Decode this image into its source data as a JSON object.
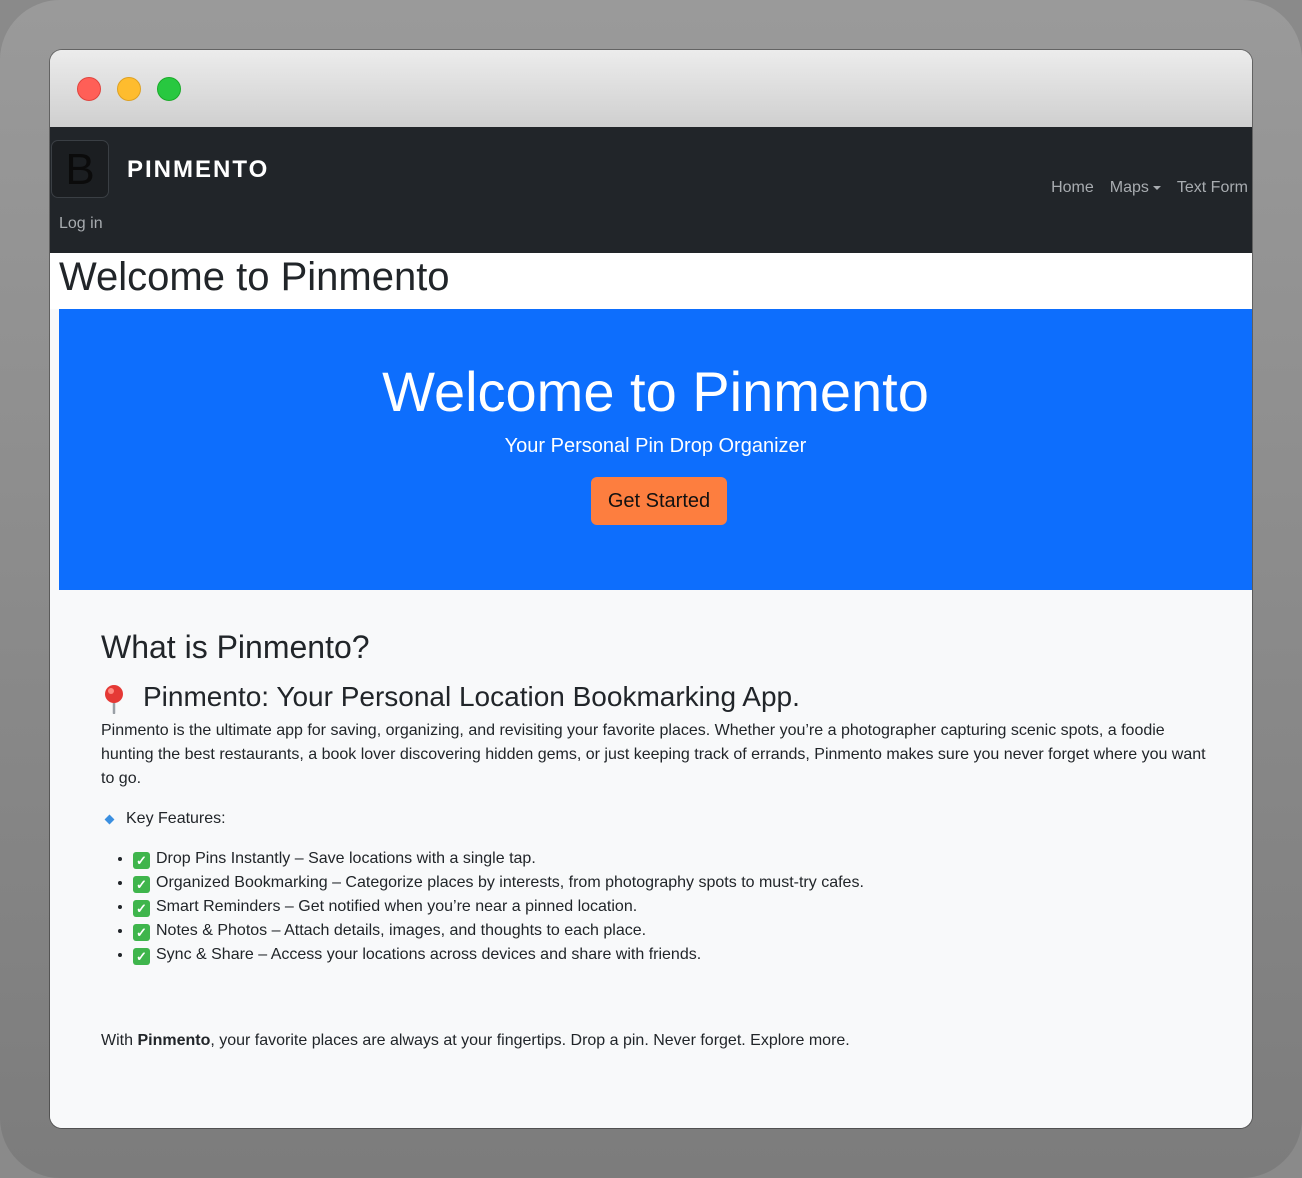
{
  "navbar": {
    "brand_logo_letter": "B",
    "brand_name": "PINMENTO",
    "links": {
      "home": "Home",
      "maps": "Maps",
      "text_form": "Text Form"
    },
    "login": "Log in"
  },
  "page": {
    "title": "Welcome to Pinmento"
  },
  "hero": {
    "title": "Welcome to Pinmento",
    "subtitle": "Your Personal Pin Drop Organizer",
    "button": "Get Started"
  },
  "about": {
    "heading": "What is Pinmento?",
    "subheading": "Pinmento: Your Personal Location Bookmarking App.",
    "description": "Pinmento is the ultimate app for saving, organizing, and revisiting your favorite places. Whether you’re a photographer capturing scenic spots, a foodie hunting the best restaurants, a book lover discovering hidden gems, or just keeping track of errands, Pinmento makes sure you never forget where you want to go.",
    "features_label": "Key Features:",
    "features": [
      "Drop Pins Instantly – Save locations with a single tap.",
      "Organized Bookmarking – Categorize places by interests, from photography spots to must-try cafes.",
      "Smart Reminders – Get notified when you’re near a pinned location.",
      "Notes & Photos – Attach details, images, and thoughts to each place.",
      "Sync & Share – Access your locations across devices and share with friends."
    ],
    "closing_prefix": "With ",
    "closing_bold": "Pinmento",
    "closing_suffix": ", your favorite places are always at your fingertips. Drop a pin. Never forget. Explore more."
  },
  "colors": {
    "navbar_bg": "#212529",
    "hero_bg": "#0d6efd",
    "hero_button_bg": "#fd7e3f",
    "check_icon": "#3fb54c"
  },
  "icons": {
    "pin": "round-pushpin-icon",
    "features": "small-blue-diamond-icon",
    "check": "check-mark-button-icon"
  }
}
